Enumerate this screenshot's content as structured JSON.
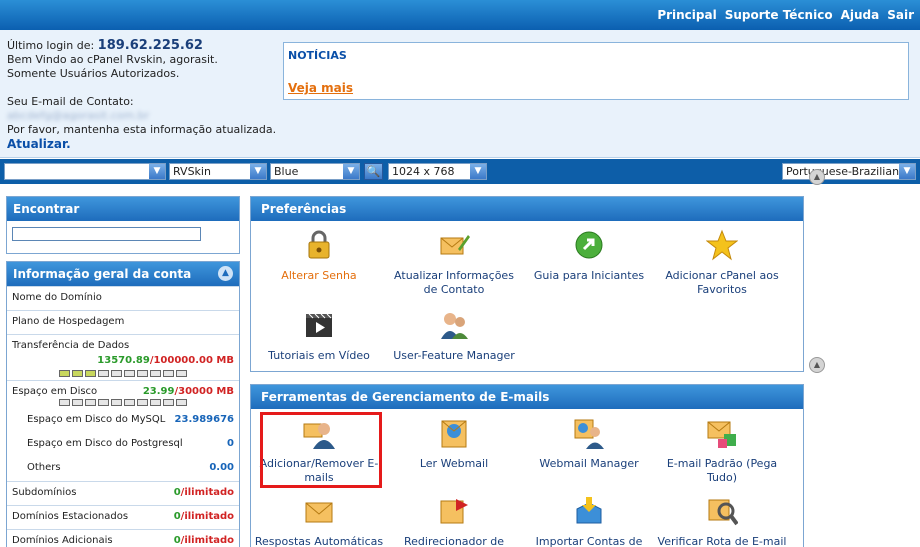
{
  "nav": [
    "Principal",
    "Suporte Técnico",
    "Ajuda",
    "Sair"
  ],
  "info": {
    "last_login_label": "Último login de:",
    "last_login_ip": "189.62.225.62",
    "welcome": "Bem Vindo ao cPanel Rvskin, agorasit.",
    "authorized": "Somente Usuários Autorizados.",
    "contact_label": "Seu E-mail de Contato:",
    "contact_email": "abcdefg@agorasit.com.br",
    "keep_updated": "Por favor, mantenha esta informação atualizada.",
    "update_link": "Atualizar."
  },
  "news": {
    "title": "NOTÍCIAS",
    "more": "Veja mais"
  },
  "selectors": {
    "theme": "RVSkin",
    "color": "Blue",
    "resolution": "1024 x 768",
    "language": "Portuguese-Brazilian"
  },
  "find": {
    "title": "Encontrar"
  },
  "account": {
    "title": "Informação geral da conta",
    "domain": "Nome do Domínio",
    "plan": "Plano de Hospedagem",
    "transfer": "Transferência de Dados",
    "transfer_used": "13570.89",
    "transfer_total": "100000.00 MB",
    "disk": "Espaço em Disco",
    "disk_used": "23.99",
    "disk_total": "30000 MB",
    "mysql": "Espaço em Disco do MySQL",
    "mysql_val": "23.989676",
    "pg": "Espaço em Disco do Postgresql",
    "pg_val": "0",
    "others": "Others",
    "others_val": "0.00",
    "sub": "Subdomínios",
    "sub_used": "0",
    "parked": "Domínios Estacionados",
    "parked_used": "0",
    "addon": "Domínios Adicionais",
    "addon_used": "0",
    "unlimited": "ilimitado"
  },
  "preferences": {
    "title": "Preferências",
    "items": [
      {
        "label": "Alterar Senha",
        "icon": "lock-icon"
      },
      {
        "label": "Atualizar Informações de Contato",
        "icon": "contact-icon"
      },
      {
        "label": "Guia para Iniciantes",
        "icon": "guide-icon"
      },
      {
        "label": "Adicionar cPanel aos Favoritos",
        "icon": "star-icon"
      },
      {
        "label": "Tutoriais em Vídeo",
        "icon": "video-icon"
      },
      {
        "label": "User-Feature Manager",
        "icon": "users-icon"
      }
    ]
  },
  "email_tools": {
    "title": "Ferramentas de Gerenciamento de E-mails",
    "items": [
      {
        "label": "Adicionar/Remover E-mails",
        "icon": "add-email-icon"
      },
      {
        "label": "Ler Webmail",
        "icon": "webmail-icon"
      },
      {
        "label": "Webmail Manager",
        "icon": "webmail-manager-icon"
      },
      {
        "label": "E-mail Padrão (Pega Tudo)",
        "icon": "default-email-icon"
      },
      {
        "label": "Respostas Automáticas",
        "icon": "autoresponder-icon"
      },
      {
        "label": "Redirecionador de",
        "icon": "forwarder-icon"
      },
      {
        "label": "Importar Contas de",
        "icon": "import-icon"
      },
      {
        "label": "Verificar Rota de E-mail",
        "icon": "trace-icon"
      }
    ]
  },
  "colors": {
    "accent": "#1e6cbc",
    "highlight": "#e51a1a",
    "link_orange": "#e46f0d"
  }
}
